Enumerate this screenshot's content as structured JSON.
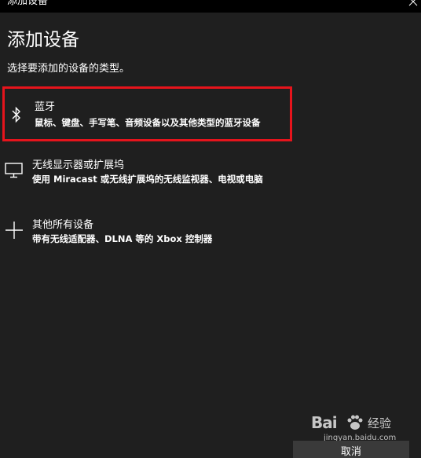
{
  "window": {
    "title": "添加设备",
    "close_icon": "close-icon"
  },
  "page": {
    "heading": "添加设备",
    "subtitle": "选择要添加的设备的类型。"
  },
  "options": [
    {
      "icon": "bluetooth-icon",
      "label": "蓝牙",
      "description": "鼠标、键盘、手写笔、音频设备以及其他类型的蓝牙设备",
      "highlighted": true,
      "highlight_color": "#e6141c"
    },
    {
      "icon": "monitor-icon",
      "label": "无线显示器或扩展坞",
      "description": "使用 Miracast 或无线扩展坞的无线监视器、电视或电脑"
    },
    {
      "icon": "plus-icon",
      "label": "其他所有设备",
      "description": "带有无线适配器、DLNA 等的 Xbox 控制器"
    }
  ],
  "footer": {
    "cancel_label": "取消"
  },
  "watermark": {
    "brand_left": "Bai",
    "brand_right": "经验",
    "url": "jingyan.baidu.com"
  },
  "colors": {
    "background": "#1f1f1f",
    "titlebar": "#000000",
    "text": "#ffffff",
    "highlight": "#e6141c",
    "button": "#3a3a3a"
  }
}
